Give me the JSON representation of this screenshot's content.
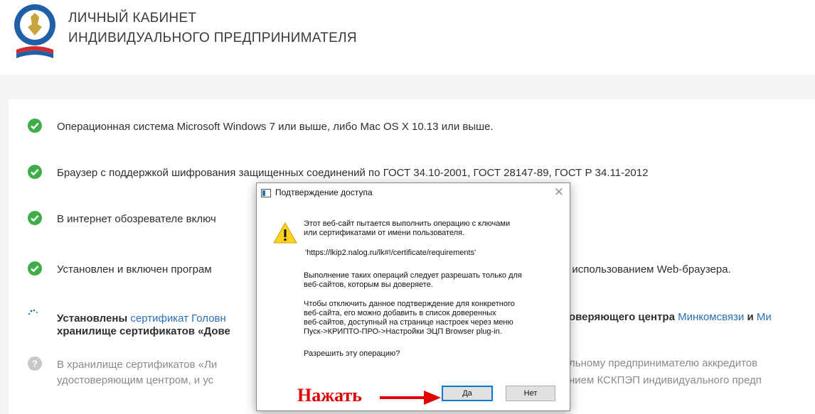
{
  "header": {
    "title_line1": "ЛИЧНЫЙ КАБИНЕТ",
    "title_line2": "ИНДИВИДУАЛЬНОГО ПРЕДПРИНИМАТЕЛЯ"
  },
  "requirements": [
    {
      "status": "ok",
      "text": "Операционная система Microsoft Windows 7 или выше, либо Mac OS X 10.13 или выше."
    },
    {
      "status": "ok",
      "text": "Браузер с поддержкой шифрования защищенных соединений по ГОСТ 34.10-2001, ГОСТ 28147-89, ГОСТ Р 34.11-2012"
    },
    {
      "status": "ok",
      "text": "В интернет обозревателе включ"
    },
    {
      "status": "ok",
      "text_left": "Установлен и включен програм",
      "text_right": "сью с использованием Web-браузера."
    },
    {
      "status": "loading",
      "line1_a": "Установлены ",
      "line1_link1": "сертификат Головн",
      "line1_b": "оверяющего центра ",
      "line1_link2": "Минкомсвязи",
      "line1_c": " и ",
      "line1_link3": "Ми",
      "line2": "хранилище сертификатов «Дове"
    },
    {
      "status": "pending",
      "line1_a": "В хранилище сертификатов «Ли",
      "line1_b": "льному предпринимателю аккредитов",
      "line2_a": "удостоверяющим центром, и ус",
      "line2_b": "нием КСКПЭП индивидуального предп"
    }
  ],
  "dialog": {
    "title": "Подтверждение доступа",
    "close": "✕",
    "message1": "Этот веб-сайт пытается выполнить операцию с ключами\nили сертификатами от имени пользователя.",
    "url": "'https://lkip2.nalog.ru/lk#!/certificate/requirements'",
    "message2": "Выполнение таких операций следует разрешать только для\nвеб-сайтов, которым вы доверяете.",
    "message3": "Чтобы отключить данное подтверждение для конкретного\nвеб-сайта, его можно добавить в список доверенных\nвеб-сайтов, доступный на странице настроек через меню\nПуск->КРИПТО-ПРО->Настройки ЭЦП Browser plug-in.",
    "question": "Разрешить эту операцию?",
    "yes_label": "Да",
    "no_label": "Нет"
  },
  "annotation": {
    "press_label": "Нажать"
  },
  "colors": {
    "ok_green": "#3fae49",
    "link_blue": "#2a6fb6",
    "annotation_red": "#e00000"
  }
}
